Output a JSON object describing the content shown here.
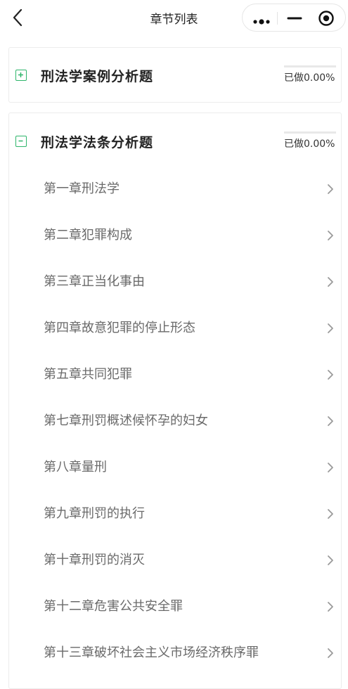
{
  "navbar": {
    "title": "章节列表"
  },
  "sections": [
    {
      "title": "刑法学案例分析题",
      "toggle": "+",
      "progress_text": "已做0.00%",
      "progress": 0.0,
      "expanded": false
    },
    {
      "title": "刑法学法条分析题",
      "toggle": "-",
      "progress_text": "已做0.00%",
      "progress": 0.0,
      "expanded": true
    }
  ],
  "chapters": [
    "第一章刑法学",
    "第二章犯罪构成",
    "第三章正当化事由",
    "第四章故意犯罪的停止形态",
    "第五章共同犯罪",
    "第七章刑罚概述候怀孕的妇女",
    "第八章量刑",
    "第九章刑罚的执行",
    "第十章刑罚的消灭",
    "第十二章危害公共安全罪",
    "第十三章破坏社会主义市场经济秩序罪"
  ],
  "colors": {
    "accent": "#2fb56b",
    "chapter_text": "#6a6a6a",
    "chevron": "#9a9a9a"
  },
  "icons": {
    "back": "chevron-left-icon",
    "more": "more-dots-icon",
    "minimize": "minimize-icon",
    "close": "target-circle-icon",
    "chapter_arrow": "chevron-right-icon"
  }
}
